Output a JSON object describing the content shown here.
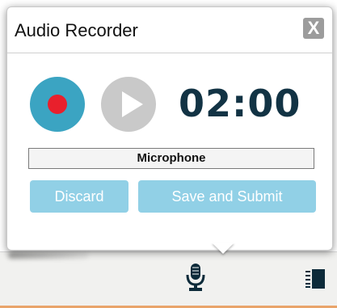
{
  "window": {
    "title": "Audio Recorder",
    "close_label": "X"
  },
  "recorder": {
    "timer": "02:00",
    "input_source": "Microphone",
    "record_color": "#3ba4c2",
    "record_dot_color": "#e8202c",
    "play_color": "#c9c9c9",
    "timer_color": "#123344"
  },
  "actions": {
    "discard_label": "Discard",
    "save_label": "Save and Submit",
    "button_color": "#91d0e6"
  },
  "toolbar": {
    "icons": [
      "microphone-icon",
      "list-icon"
    ],
    "accent_color": "#e9a46a"
  }
}
